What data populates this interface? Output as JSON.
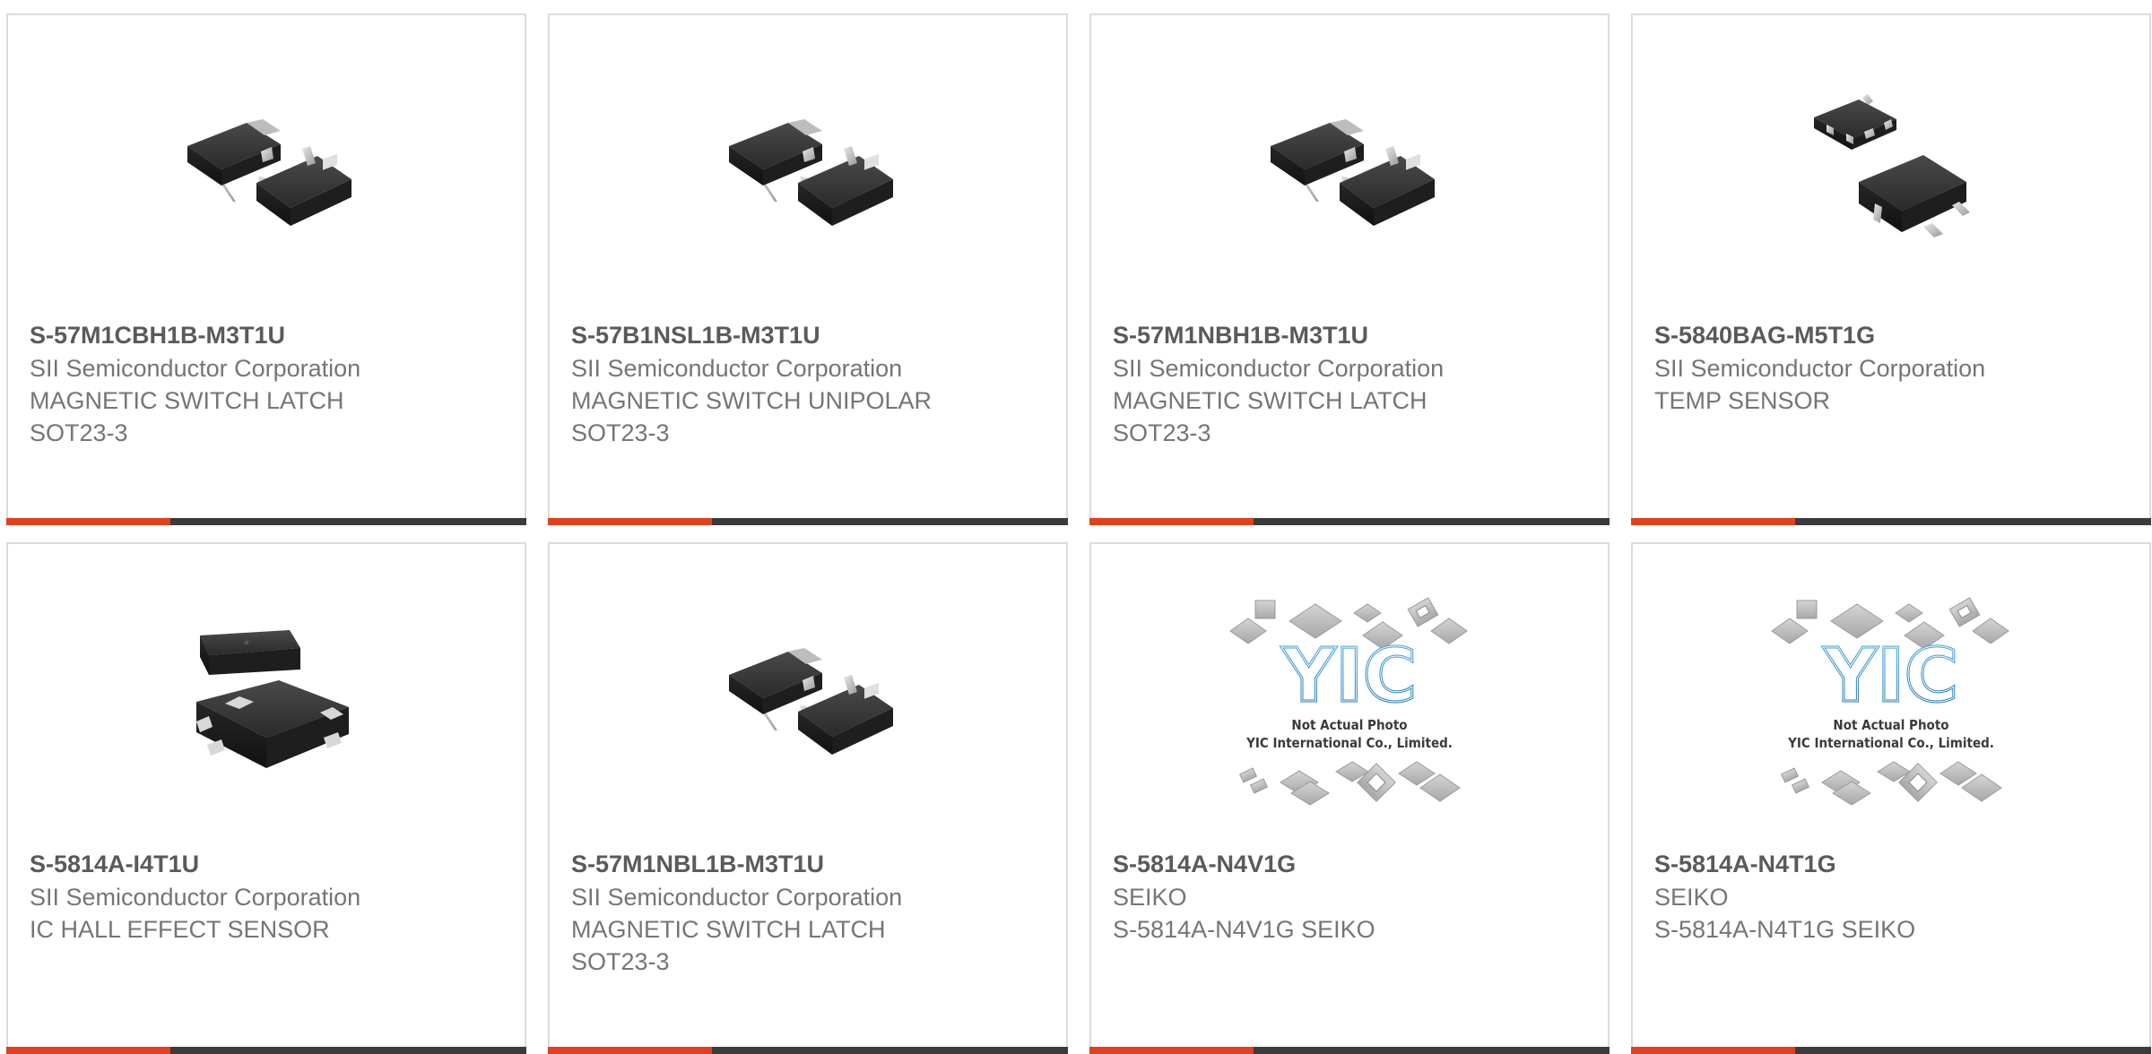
{
  "products": [
    {
      "part_number": "S-57M1CBH1B-M3T1U",
      "manufacturer": "SII Semiconductor Corporation",
      "description": "MAGNETIC SWITCH LATCH",
      "package": "SOT23-3",
      "image_icon": "sot23-3-package-icon"
    },
    {
      "part_number": "S-57B1NSL1B-M3T1U",
      "manufacturer": "SII Semiconductor Corporation",
      "description": "MAGNETIC SWITCH UNIPOLAR",
      "package": "SOT23-3",
      "image_icon": "sot23-3-package-icon"
    },
    {
      "part_number": "S-57M1NBH1B-M3T1U",
      "manufacturer": "SII Semiconductor Corporation",
      "description": "MAGNETIC SWITCH LATCH",
      "package": "SOT23-3",
      "image_icon": "sot23-3-package-icon"
    },
    {
      "part_number": "S-5840BAG-M5T1G",
      "manufacturer": "SII Semiconductor Corporation",
      "description": "TEMP SENSOR",
      "package": "",
      "image_icon": "sot23-5-package-icon"
    },
    {
      "part_number": "S-5814A-I4T1U",
      "manufacturer": "SII Semiconductor Corporation",
      "description": "IC HALL EFFECT SENSOR",
      "package": "",
      "image_icon": "snt-4a-package-icon"
    },
    {
      "part_number": "S-57M1NBL1B-M3T1U",
      "manufacturer": "SII Semiconductor Corporation",
      "description": "MAGNETIC SWITCH LATCH",
      "package": "SOT23-3",
      "image_icon": "sot23-3-package-icon"
    },
    {
      "part_number": "S-5814A-N4V1G",
      "manufacturer": "SEIKO",
      "description": "S-5814A-N4V1G SEIKO",
      "package": "",
      "image_icon": "placeholder-photo-icon",
      "placeholder_lines": [
        "Not Actual Photo",
        "YIC International Co., Limited."
      ],
      "placeholder_logo": "YIC"
    },
    {
      "part_number": "S-5814A-N4T1G",
      "manufacturer": "SEIKO",
      "description": "S-5814A-N4T1G SEIKO",
      "package": "",
      "image_icon": "placeholder-photo-icon",
      "placeholder_lines": [
        "Not Actual Photo",
        "YIC International Co., Limited."
      ],
      "placeholder_logo": "YIC"
    }
  ],
  "colors": {
    "accent": "#e2401c",
    "bar": "#3b3b3b",
    "border": "#dcdcdc",
    "title": "#5a5a5a",
    "text": "#757575"
  }
}
